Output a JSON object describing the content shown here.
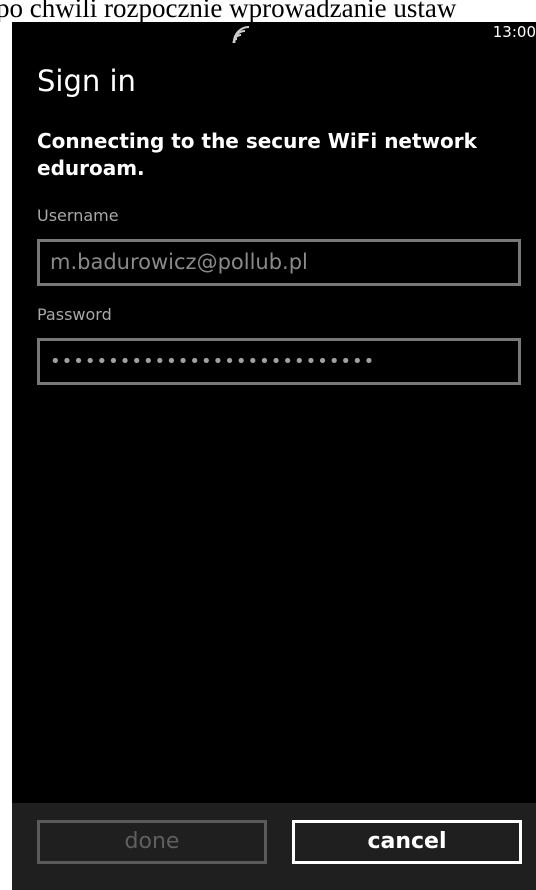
{
  "caption": {
    "text": "po chwili rozpocznie wprowadzanie ustaw"
  },
  "status_bar": {
    "signal_icon": "wifi-signal-icon",
    "time": "13:00"
  },
  "page": {
    "title": "Sign in",
    "prompt": "Connecting to the secure WiFi network eduroam."
  },
  "form": {
    "username_label": "Username",
    "username_value": "m.badurowicz@pollub.pl",
    "password_label": "Password",
    "password_value": "••••••••••••••••••••••••••••"
  },
  "app_bar": {
    "done_label": "done",
    "cancel_label": "cancel"
  },
  "colors": {
    "background": "#000000",
    "app_bar": "#1f1f1f",
    "text": "#ffffff",
    "disabled": "#5f5f5f"
  }
}
